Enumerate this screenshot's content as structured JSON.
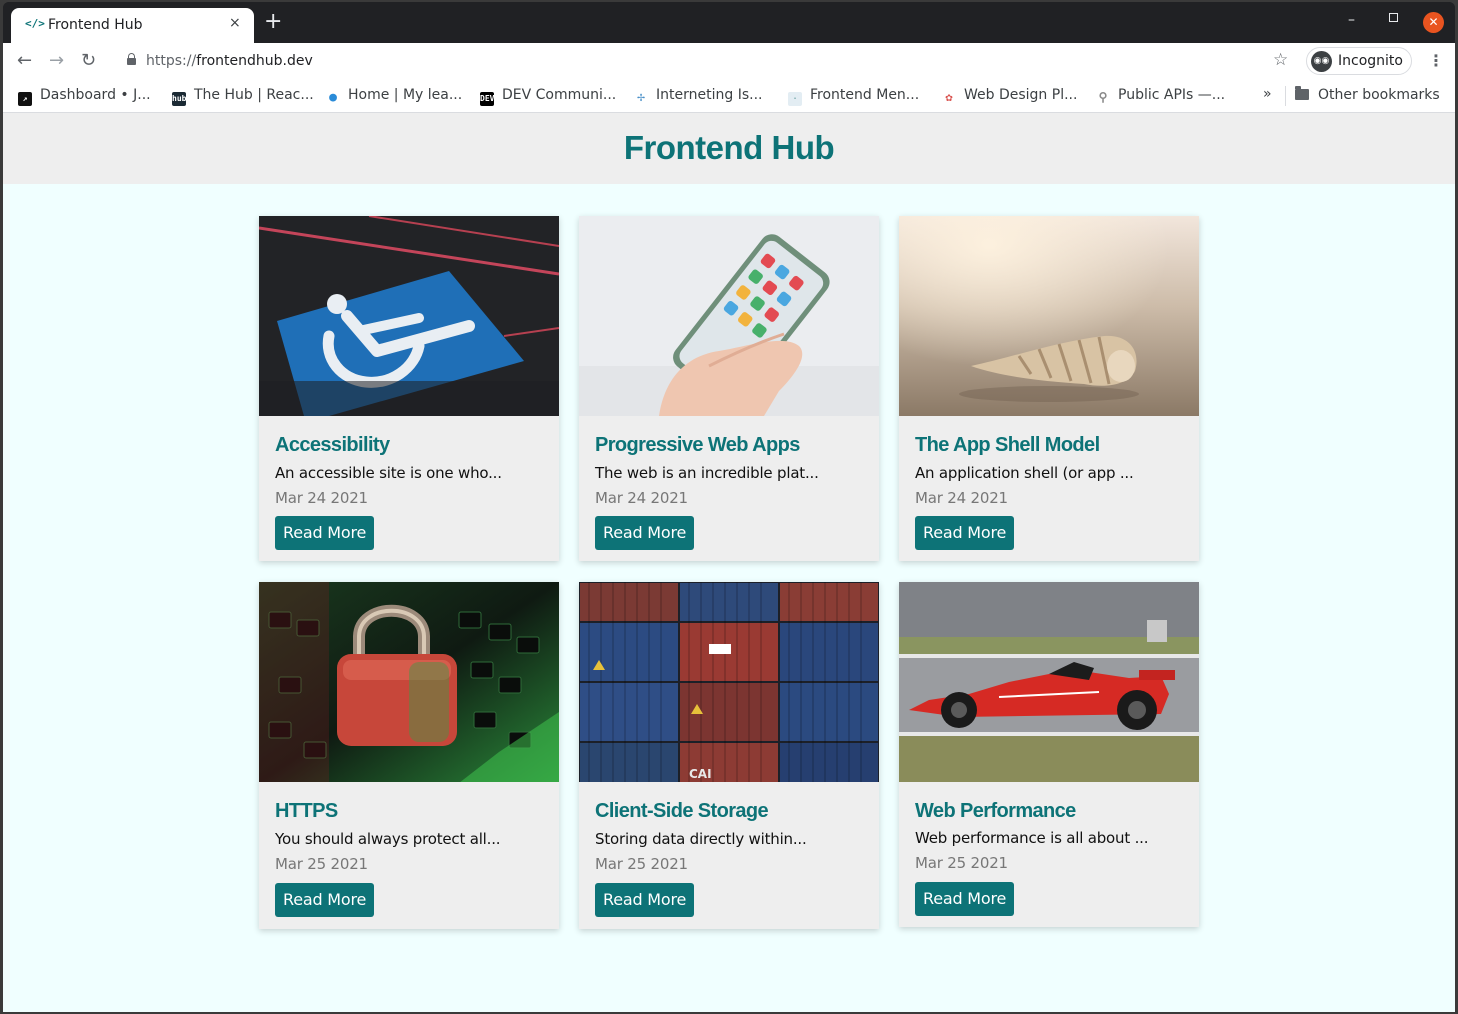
{
  "browser": {
    "tab_title": "Frontend Hub",
    "tab_favicon": "</>",
    "tab_close": "×",
    "new_tab": "+",
    "url_scheme": "https://",
    "url_host": "frontendhub.dev",
    "incognito_label": "Incognito",
    "bookmarks": [
      {
        "label": "Dashboard • J...",
        "icon": "dashboard-icon",
        "color": "#111111"
      },
      {
        "label": "The Hub | Reac...",
        "icon": "hub-icon",
        "color": "#1b2a34"
      },
      {
        "label": "Home | My lea...",
        "icon": "person-icon",
        "color": "#2a8bd8"
      },
      {
        "label": "DEV Communi...",
        "icon": "dev-icon",
        "color": "#000000"
      },
      {
        "label": "Interneting Is...",
        "icon": "interneting-icon",
        "color": "#4a90c8"
      },
      {
        "label": "Frontend Men...",
        "icon": "frontend-mentor-icon",
        "color": "#c9d9e3"
      },
      {
        "label": "Web Design Pl...",
        "icon": "web-design-icon",
        "color": "#d9534f"
      },
      {
        "label": "Public APIs —...",
        "icon": "link-icon",
        "color": "#8a8a8a"
      }
    ],
    "bookmarks_more": "»",
    "other_bookmarks": "Other bookmarks"
  },
  "site": {
    "title": "Frontend Hub",
    "accent": "#0d7377"
  },
  "cards": [
    {
      "title": "Accessibility",
      "desc": "An accessible site is one who...",
      "date": "Mar 24 2021",
      "button": "Read More",
      "image": "wheelchair-parking-image"
    },
    {
      "title": "Progressive Web Apps",
      "desc": "The web is an incredible plat...",
      "date": "Mar 24 2021",
      "button": "Read More",
      "image": "smartphone-hand-image"
    },
    {
      "title": "The App Shell Model",
      "desc": "An application shell (or app ...",
      "date": "Mar 24 2021",
      "button": "Read More",
      "image": "seashell-image"
    },
    {
      "title": "HTTPS",
      "desc": "You should always protect all...",
      "date": "Mar 25 2021",
      "button": "Read More",
      "image": "padlock-keyboard-image"
    },
    {
      "title": "Client-Side Storage",
      "desc": "Storing data directly within...",
      "date": "Mar 25 2021",
      "button": "Read More",
      "image": "shipping-containers-image"
    },
    {
      "title": "Web Performance",
      "desc": "Web performance is all about ...",
      "date": "Mar 25 2021",
      "button": "Read More",
      "image": "race-car-image"
    }
  ]
}
